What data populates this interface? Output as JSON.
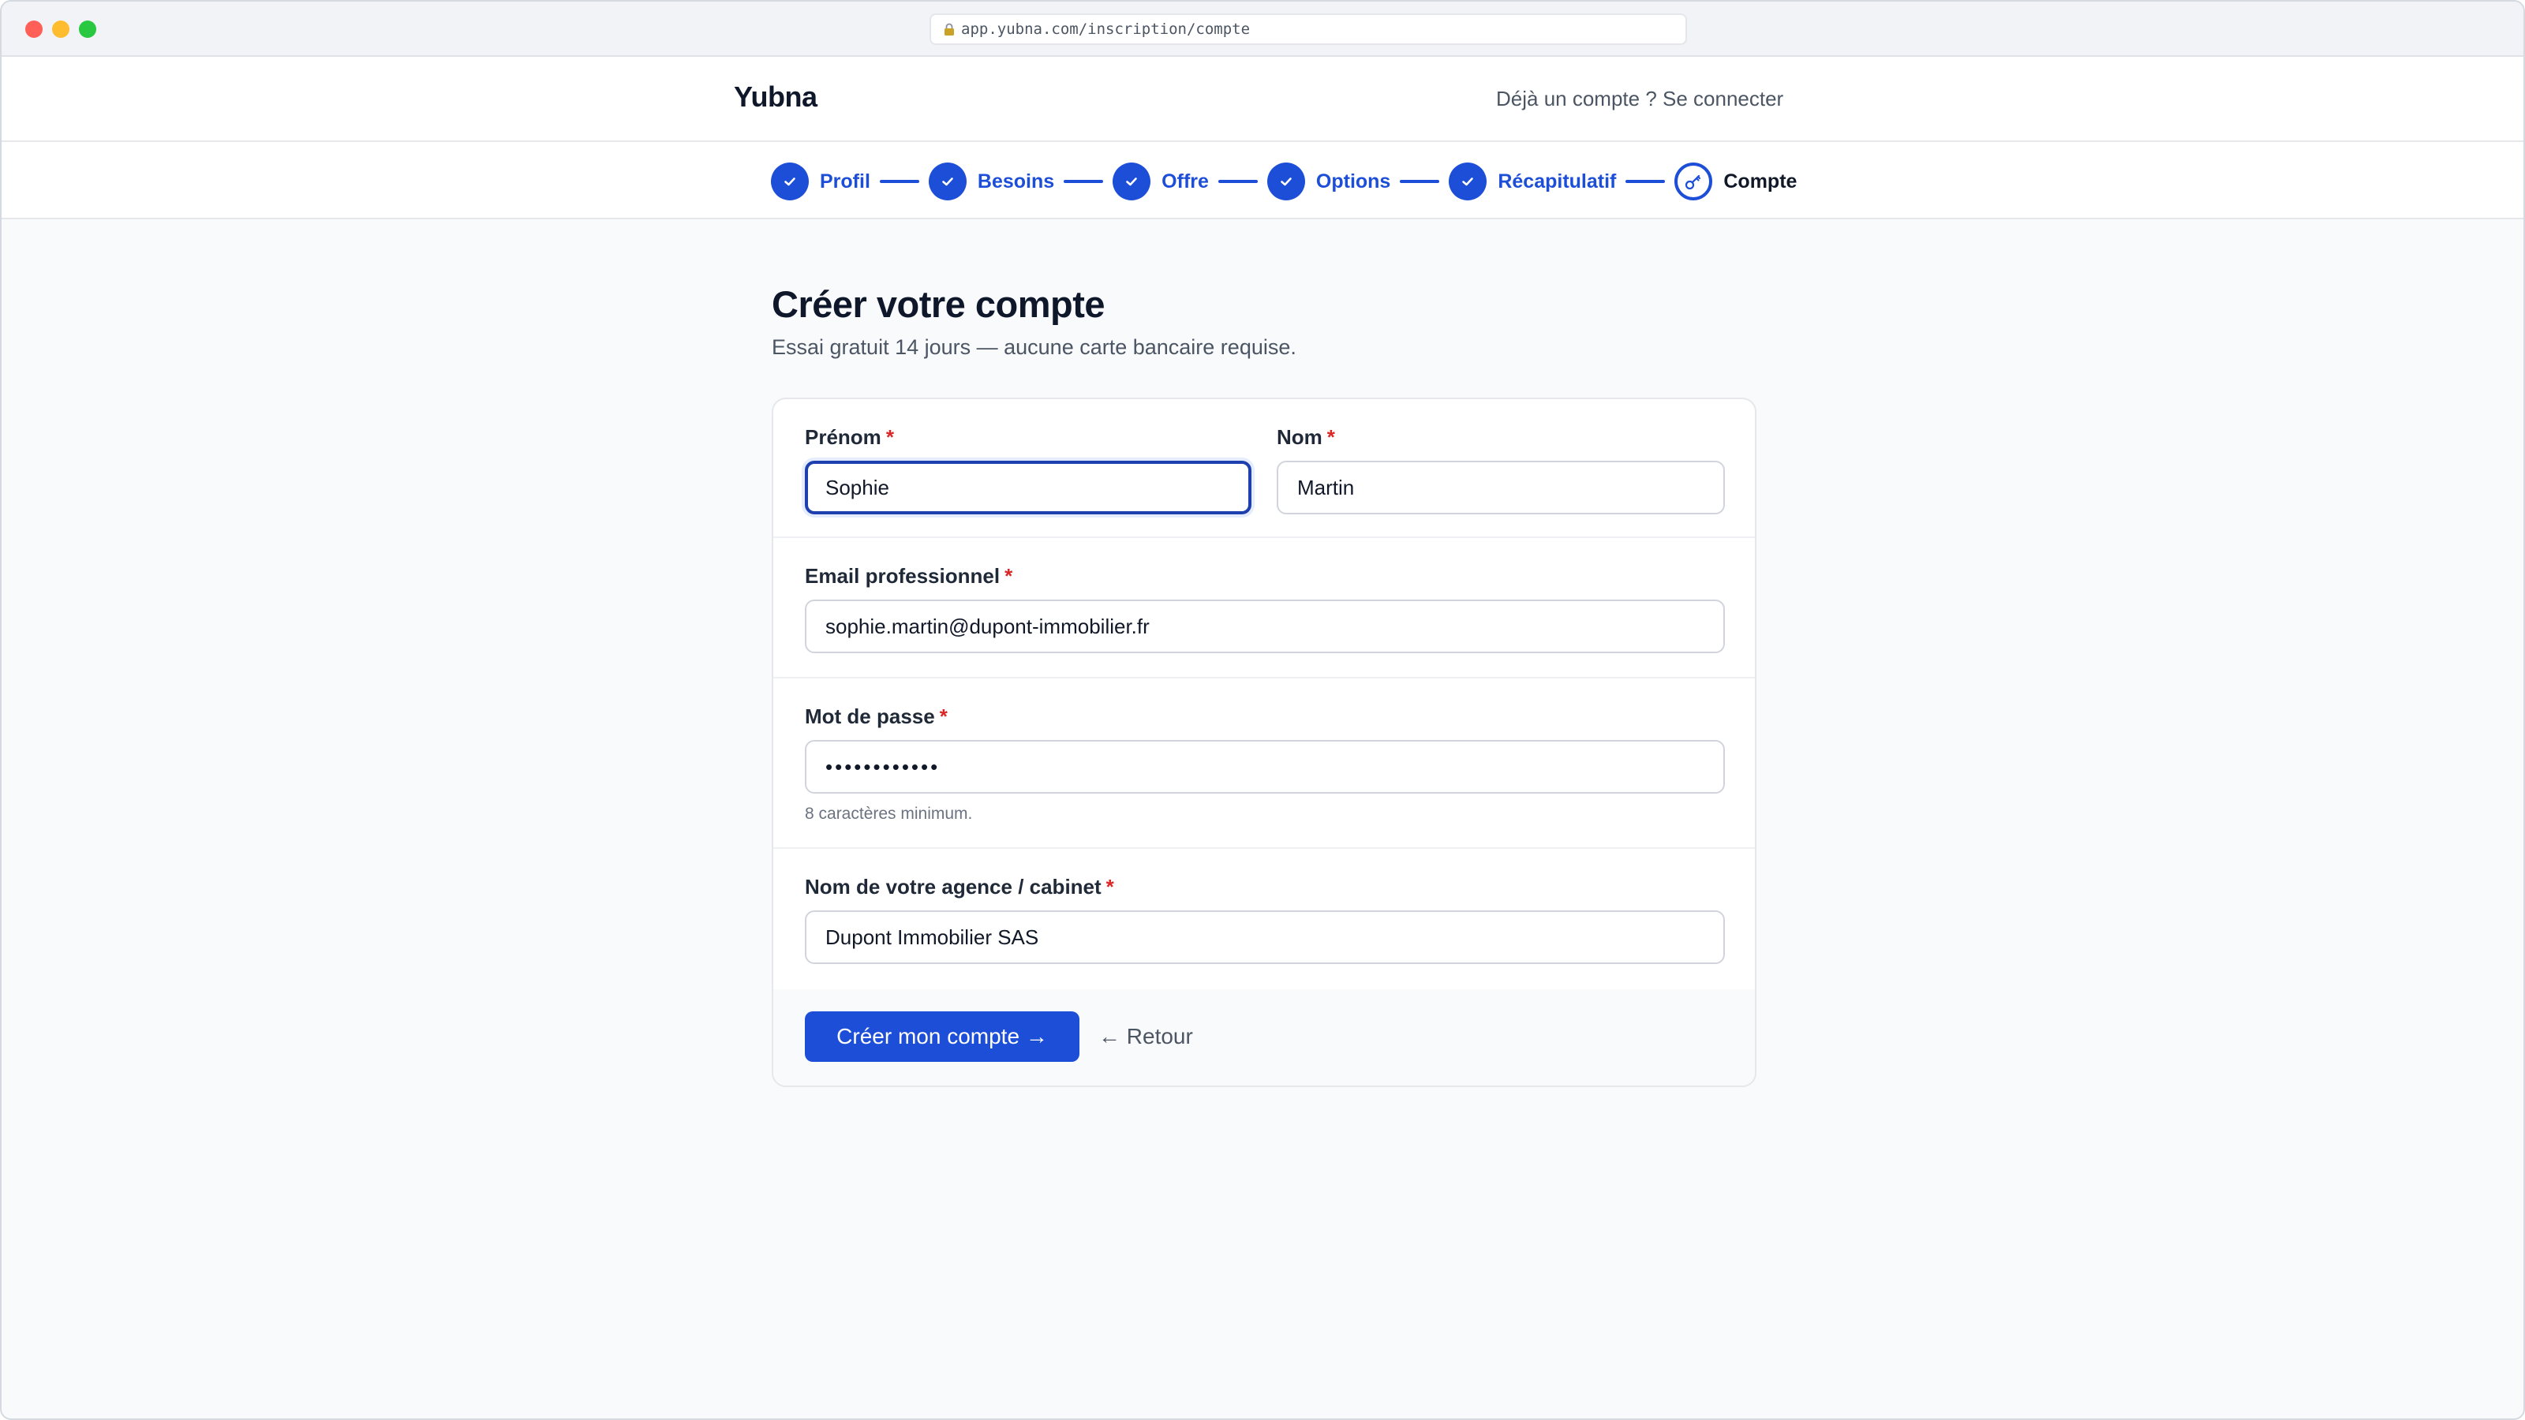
{
  "browser": {
    "url": "app.yubna.com/inscription/compte",
    "lock_icon": "lock-icon"
  },
  "header": {
    "brand": "Yubna",
    "login_prompt": "Déjà un compte ? Se connecter"
  },
  "stepper": {
    "steps": [
      {
        "label": "Profil",
        "state": "done",
        "icon": "check-icon"
      },
      {
        "label": "Besoins",
        "state": "done",
        "icon": "check-icon"
      },
      {
        "label": "Offre",
        "state": "done",
        "icon": "check-icon"
      },
      {
        "label": "Options",
        "state": "done",
        "icon": "check-icon"
      },
      {
        "label": "Récapitulatif",
        "state": "done",
        "icon": "check-icon"
      },
      {
        "label": "Compte",
        "state": "current",
        "icon": "key-icon"
      }
    ]
  },
  "main": {
    "title": "Créer votre compte",
    "subtitle": "Essai gratuit 14 jours — aucune carte bancaire requise."
  },
  "form": {
    "required_marker": "*",
    "first_name": {
      "label": "Prénom",
      "value": "Sophie"
    },
    "last_name": {
      "label": "Nom",
      "value": "Martin"
    },
    "email": {
      "label": "Email professionnel",
      "value": "sophie.martin@dupont-immobilier.fr"
    },
    "password": {
      "label": "Mot de passe",
      "value": "••••••••••••",
      "hint": "8 caractères minimum."
    },
    "agency": {
      "label": "Nom de votre agence / cabinet",
      "value": "Dupont Immobilier SAS"
    },
    "submit_label": "Créer mon compte →",
    "back_label": "← Retour"
  },
  "colors": {
    "accent": "#1d4ed8",
    "required": "#dc2626",
    "background": "#f8fafc"
  }
}
